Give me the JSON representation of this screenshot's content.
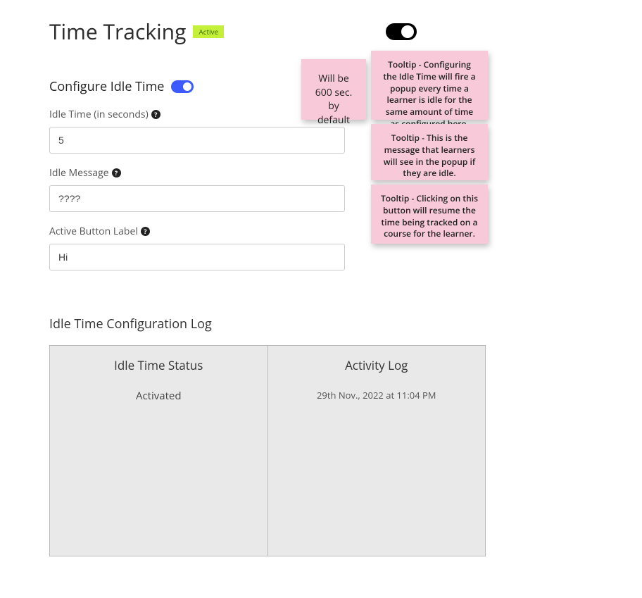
{
  "header": {
    "title": "Time Tracking",
    "status_badge": "Active"
  },
  "configure": {
    "section_title": "Configure Idle Time",
    "idle_time": {
      "label": "Idle Time (in seconds)",
      "value": "5"
    },
    "idle_message": {
      "label": "Idle Message",
      "value": "????"
    },
    "active_button": {
      "label": "Active Button Label",
      "value": "Hi"
    }
  },
  "log": {
    "title": "Idle Time Configuration Log",
    "columns": {
      "status_header": "Idle Time Status",
      "activity_header": "Activity Log"
    },
    "row": {
      "status": "Activated",
      "activity": "29th Nov., 2022 at 11:04 PM"
    }
  },
  "notes": {
    "default_hint": "Will be 600 sec. by default",
    "tooltip_idle_time": "Tooltip - Configuring the Idle Time will fire a popup every time a learner is idle for the same amount of time as configured here.",
    "tooltip_idle_message": "Tooltip - This is the message that learners will see in the popup if they are idle.",
    "tooltip_active_button": "Tooltip - Clicking on this button will resume the time being tracked on a course for the learner."
  }
}
